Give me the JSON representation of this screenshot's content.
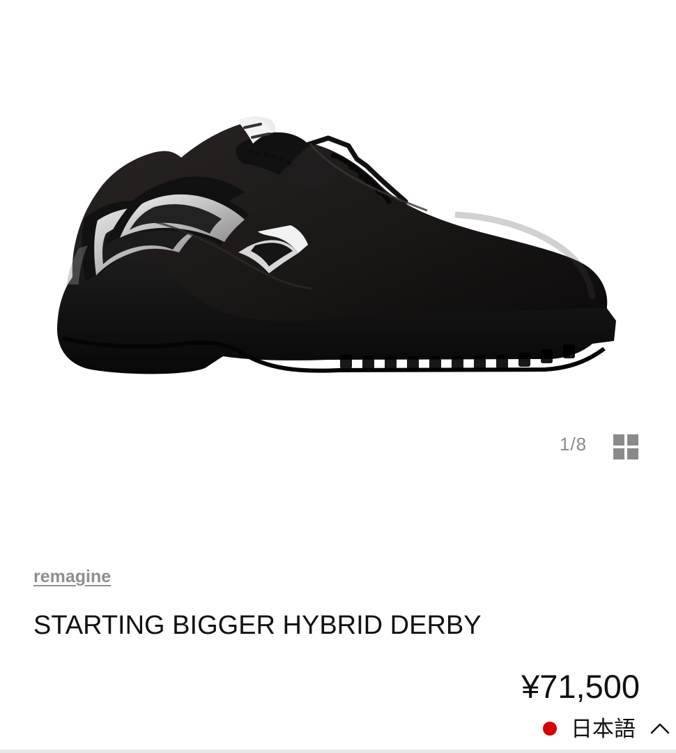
{
  "gallery": {
    "image_icon": "sneaker-product-image",
    "current_page": 1,
    "total_pages": 8,
    "pager_text": "1/8",
    "grid_icon": "grid-icon"
  },
  "product": {
    "brand": "remagine",
    "title": "STARTING BIGGER HYBRID DERBY",
    "price": "¥71,500"
  },
  "language": {
    "label": "日本語",
    "flag_icon": "japan-flag-icon",
    "caret_icon": "chevron-up-icon"
  },
  "colors": {
    "background": "#ffffff",
    "text": "#111111",
    "muted_text": "#8f8f8f",
    "flag_red": "#d70000"
  }
}
